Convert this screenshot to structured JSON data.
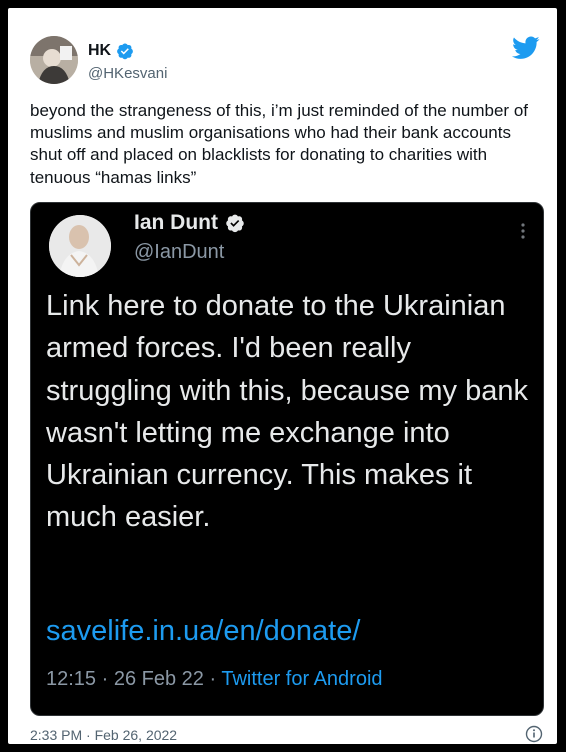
{
  "tweet": {
    "author_name": "HK",
    "author_handle": "@HKesvani",
    "text": "beyond the strangeness of this, i’m just reminded of the number of muslims and muslim organisations who had their bank accounts shut off and placed on blacklists for donating to charities with tenuous “hamas links”",
    "timestamp": "2:33 PM · Feb 26, 2022"
  },
  "quoted": {
    "author_name": "Ian Dunt",
    "author_handle": "@IanDunt",
    "text": "Link here to donate to the Ukrainian armed forces. I'd been really struggling with this, because my bank wasn't letting me exchange into Ukrainian currency. This makes it much easier.",
    "link": "savelife.in.ua/en/donate/",
    "time": "12:15",
    "date": "26 Feb 22",
    "source": "Twitter for Android"
  },
  "colors": {
    "twitter_blue": "#1d9bf0",
    "embed_bg": "#000000",
    "text_dark": "#0f1419",
    "muted": "#536471"
  },
  "icons": {
    "logo": "twitter-bird-icon",
    "verified": "verified-badge-icon",
    "more": "more-vertical-icon",
    "info": "info-icon"
  }
}
